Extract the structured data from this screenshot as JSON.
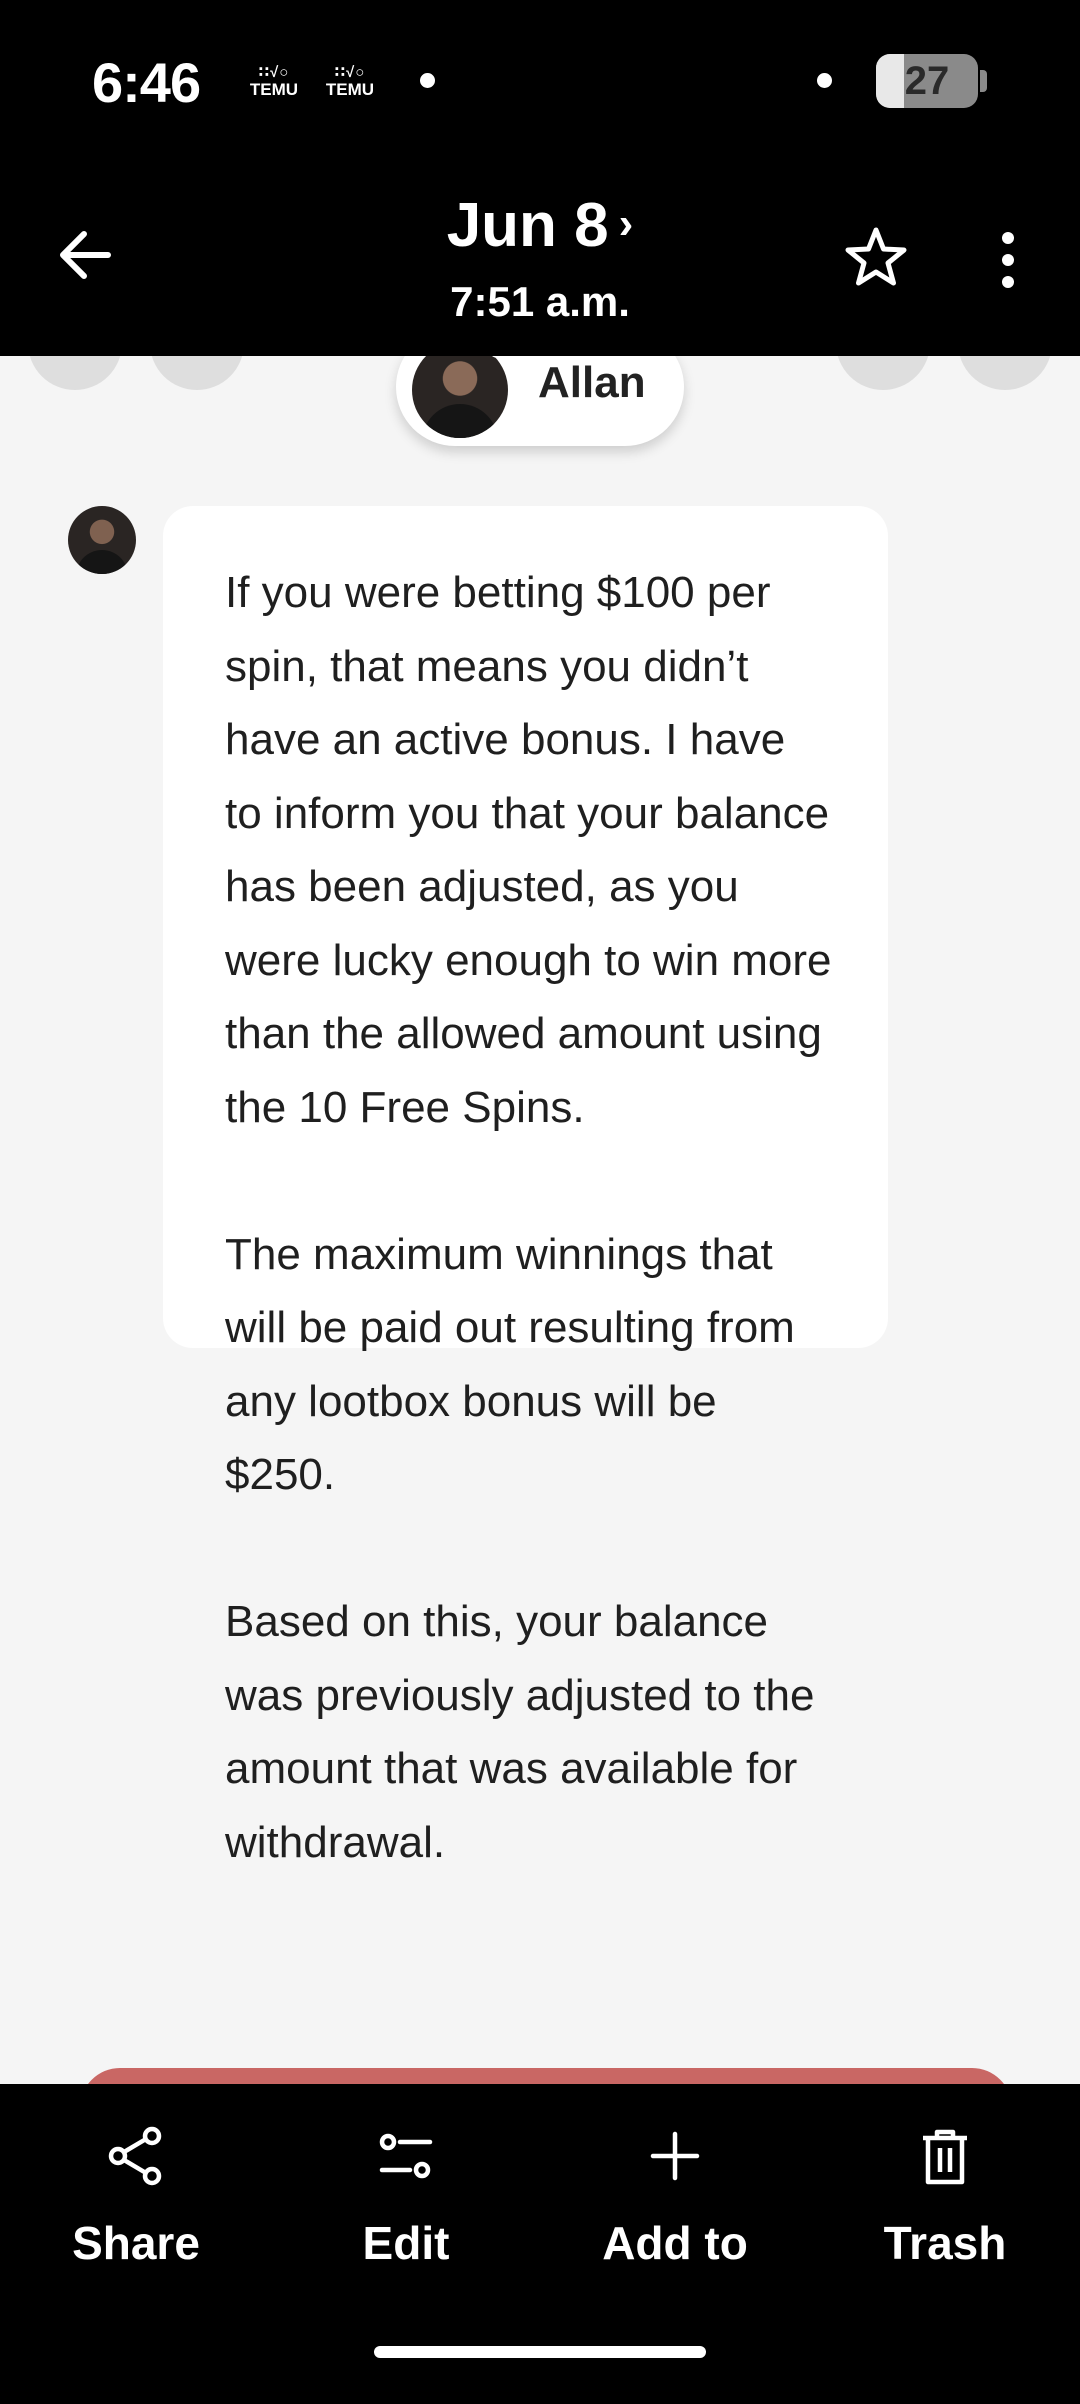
{
  "status_bar": {
    "time": "6:46",
    "notification_icons": [
      "TEMU",
      "TEMU"
    ],
    "battery_level": "27",
    "battery_fraction": 0.27
  },
  "header": {
    "date": "Jun 8",
    "time": "7:51 a.m.",
    "icons": {
      "back": "arrow-left-icon",
      "date_chevron": "chevron-right-icon",
      "favorite": "star-icon",
      "more": "more-vertical-icon"
    }
  },
  "sender": {
    "name": "Allan",
    "online": true
  },
  "message": {
    "paragraphs": [
      "If you were betting $100 per spin, that means you didn’t have an active bonus. I have to inform you that your balance has been adjusted, as you were lucky enough to win more than the allowed amount using the 10 Free Spins.",
      "The maximum winnings that will be paid out resulting from any lootbox bonus will be $250.",
      "Based on this, your balance was previously adjusted to the amount that was available for withdrawal."
    ]
  },
  "colors": {
    "bar_background": "#000000",
    "content_background": "#f5f5f5",
    "bubble_background": "#ffffff",
    "online_indicator": "#2bb54c",
    "peek_bar": "#c96764"
  },
  "bottom_bar": {
    "actions": [
      {
        "label": "Share",
        "icon": "share-icon"
      },
      {
        "label": "Edit",
        "icon": "sliders-icon"
      },
      {
        "label": "Add to",
        "icon": "plus-icon"
      },
      {
        "label": "Trash",
        "icon": "trash-icon"
      }
    ]
  }
}
